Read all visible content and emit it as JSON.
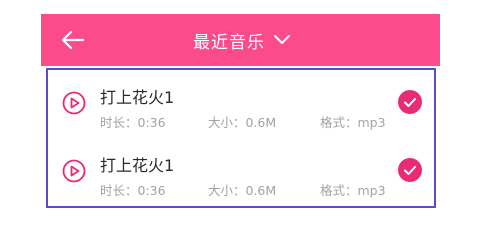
{
  "header": {
    "title": "最近音乐",
    "back_icon": "arrow-left-icon",
    "dropdown_icon": "chevron-down-icon",
    "background_color": "#fc4b8b"
  },
  "list": {
    "border_color": "#5b4dc4",
    "accent_color": "#e92a74",
    "items": [
      {
        "title": "打上花火1",
        "duration": "时长：0:36",
        "size": "大小：0.6M",
        "format": "格式：mp3",
        "selected": true
      },
      {
        "title": "打上花火1",
        "duration": "时长：0:36",
        "size": "大小：0.6M",
        "format": "格式：mp3",
        "selected": true
      }
    ]
  }
}
